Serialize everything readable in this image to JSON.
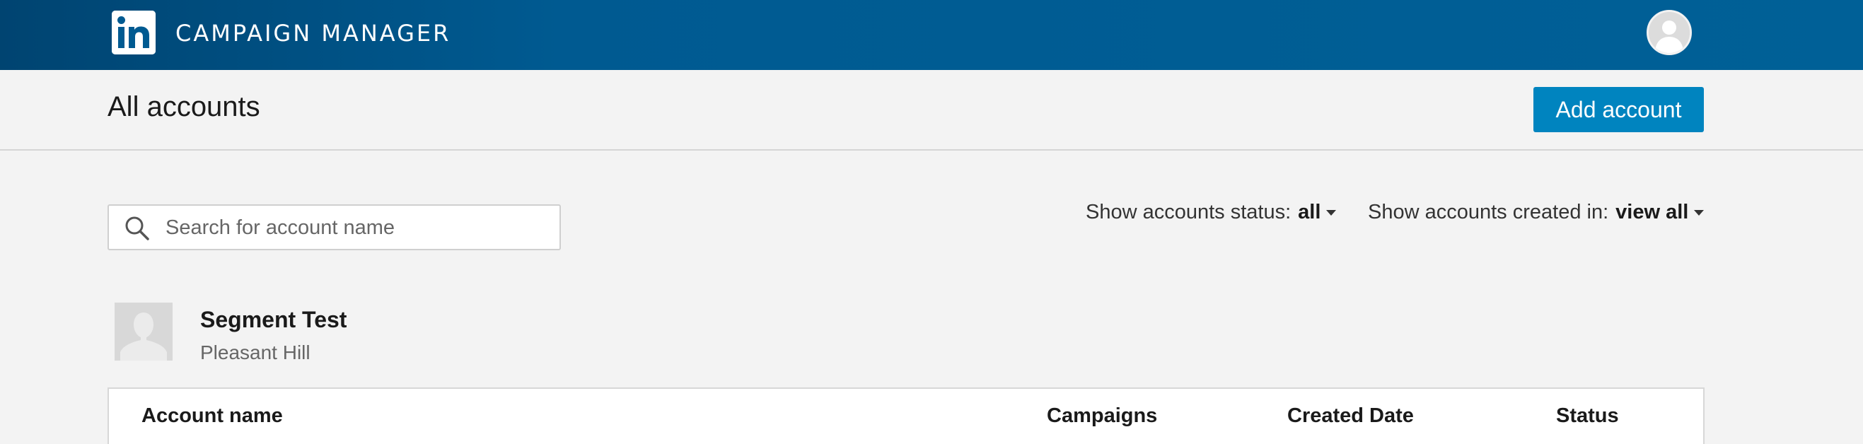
{
  "header": {
    "logo_text": "in",
    "app_title": "CAMPAIGN MANAGER",
    "brand_color": "#0073b1",
    "avatar_icon": "user-avatar-icon"
  },
  "subheader": {
    "title": "All accounts",
    "add_account_label": "Add account",
    "button_color": "#0084bf"
  },
  "search": {
    "placeholder": "Search for account name",
    "value": ""
  },
  "filters": {
    "status_label": "Show accounts status:",
    "status_value": "all",
    "created_label": "Show accounts created in:",
    "created_value": "view all"
  },
  "account": {
    "name": "Segment Test",
    "location": "Pleasant Hill",
    "avatar_icon": "company-placeholder-icon"
  },
  "table": {
    "columns": [
      "Account name",
      "Campaigns",
      "Created Date",
      "Status"
    ]
  }
}
